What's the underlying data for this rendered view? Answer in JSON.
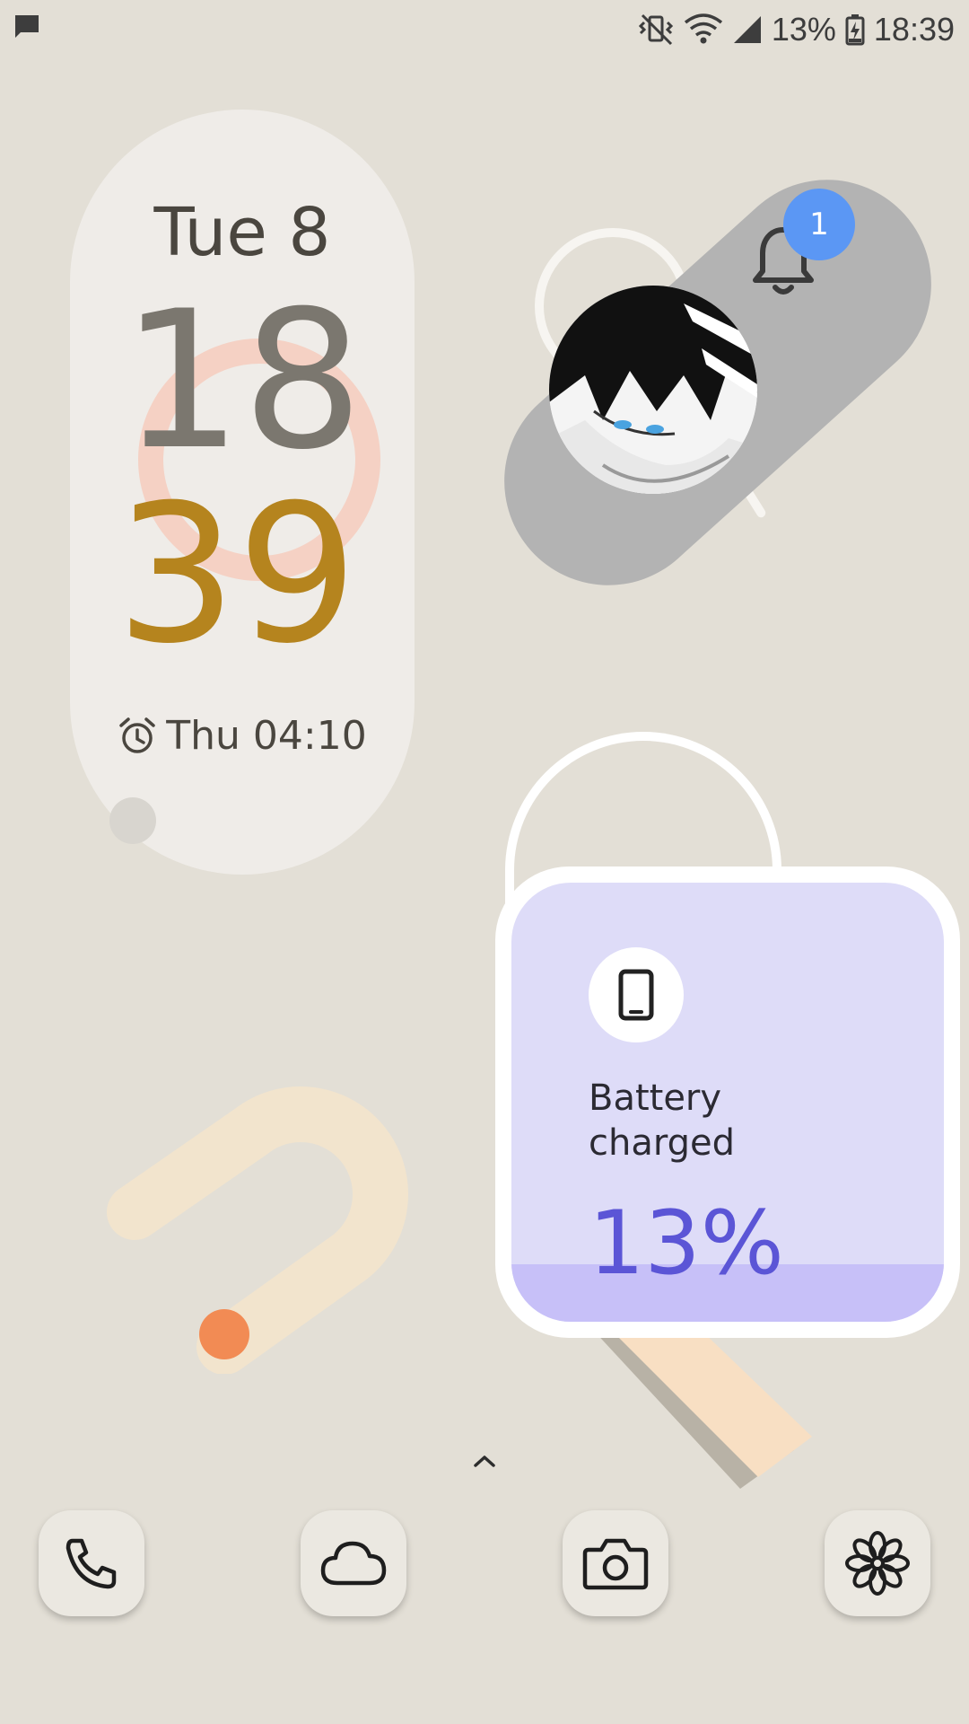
{
  "status_bar": {
    "notification_icon": "message-icon",
    "icons": [
      "vibrate-icon",
      "wifi-icon",
      "signal-icon"
    ],
    "battery_percent_text": "13%",
    "battery_icon": "battery-charging-icon",
    "time": "18:39"
  },
  "clock_widget": {
    "date": "Tue 8",
    "hour": "18",
    "minute": "39",
    "alarm_icon": "alarm-icon",
    "alarm_text": "Thu 04:10"
  },
  "notification_widget": {
    "bell_icon": "bell-icon",
    "badge_count": "1",
    "avatar": "contact-avatar"
  },
  "battery_widget": {
    "device_icon": "phone-icon",
    "label_line1": "Battery",
    "label_line2": "charged",
    "percent": "13%",
    "level": 0.13
  },
  "dock": {
    "app_drawer_icon": "chevron-up-icon",
    "apps": [
      {
        "name": "Phone",
        "icon": "phone-handset-icon"
      },
      {
        "name": "Weather",
        "icon": "cloud-icon"
      },
      {
        "name": "Camera",
        "icon": "camera-icon"
      },
      {
        "name": "Flower",
        "icon": "flower-icon"
      }
    ]
  },
  "colors": {
    "background": "#e3dfd6",
    "clock_minute": "#b5841e",
    "clock_hour": "#7b776f",
    "battery_card": "#dedcf8",
    "battery_percent": "#5b55d6",
    "badge": "#5b97f4"
  }
}
